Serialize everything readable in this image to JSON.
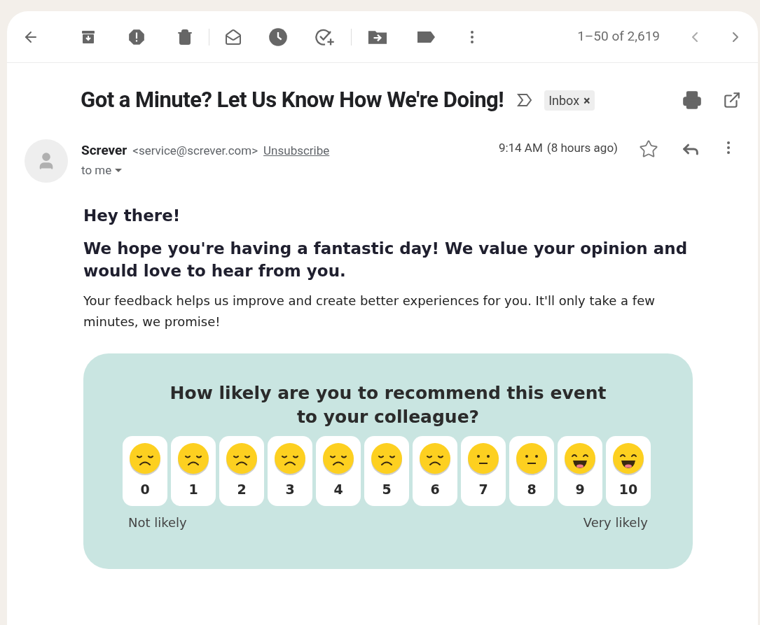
{
  "toolbar": {
    "pagination": "1–50 of 2,619"
  },
  "subject": "Got a Minute? Let Us Know How We're Doing!",
  "label": {
    "text": "Inbox",
    "remove": "×"
  },
  "sender": {
    "name": "Screver",
    "email": "<service@screver.com>",
    "unsubscribe": "Unsubscribe",
    "recipient": "to me",
    "time": "9:14 AM",
    "ago": "(8 hours ago)",
    "starred": false
  },
  "body": {
    "greeting": "Hey there!",
    "lead": "We hope you're having a fantastic day! We value your opinion and would love to hear from you.",
    "text": "Your feedback helps us improve and create better experiences for you. It'll only take a few minutes, we promise!"
  },
  "survey": {
    "question": "How likely are you to recommend this event to your colleague?",
    "options": [
      {
        "label": "0",
        "kind": "sad"
      },
      {
        "label": "1",
        "kind": "sad"
      },
      {
        "label": "2",
        "kind": "sad"
      },
      {
        "label": "3",
        "kind": "sad"
      },
      {
        "label": "4",
        "kind": "sad"
      },
      {
        "label": "5",
        "kind": "sad"
      },
      {
        "label": "6",
        "kind": "sad"
      },
      {
        "label": "7",
        "kind": "neutral"
      },
      {
        "label": "8",
        "kind": "neutral"
      },
      {
        "label": "9",
        "kind": "happy"
      },
      {
        "label": "10",
        "kind": "happy"
      }
    ],
    "low": "Not likely",
    "high": "Very likely"
  }
}
